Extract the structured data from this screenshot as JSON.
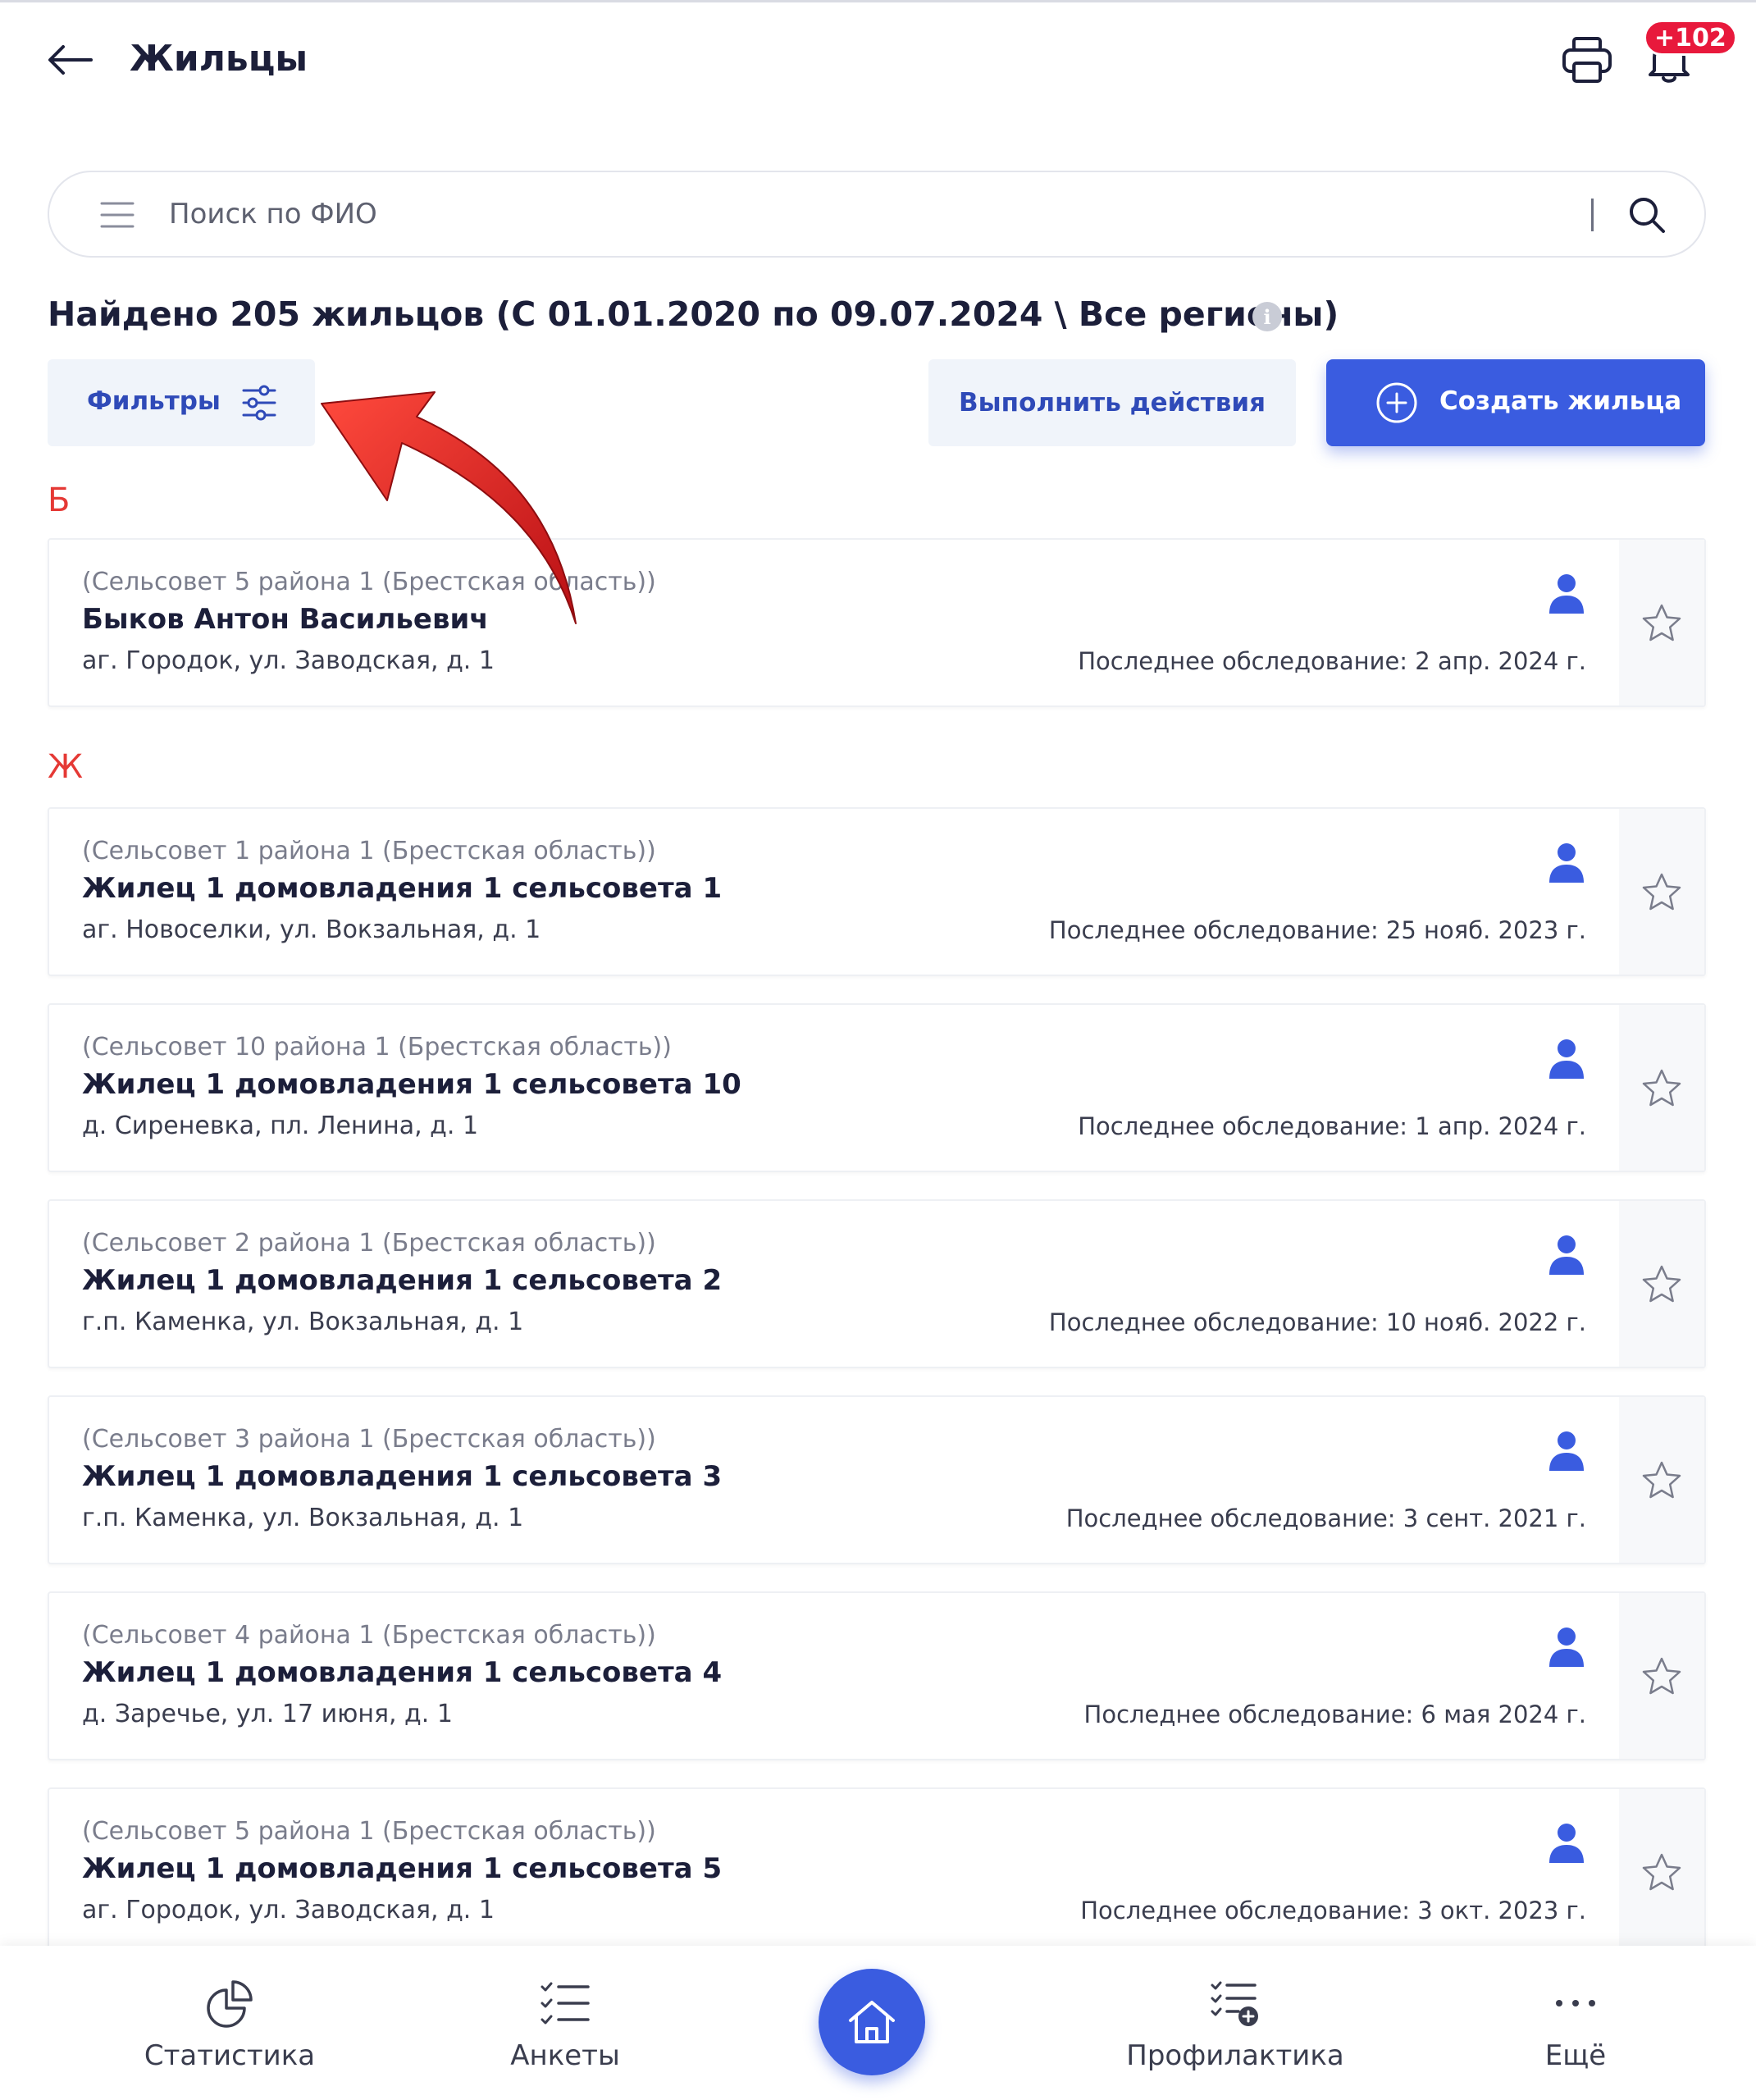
{
  "header": {
    "title": "Жильцы",
    "notification_badge": "+102"
  },
  "search": {
    "placeholder": "Поиск по ФИО",
    "value": ""
  },
  "summary": {
    "found_text": "Найдено 205 жильцов (С 01.01.2020 по 09.07.2024 \\ Все регионы)"
  },
  "toolbar": {
    "filters_label": "Фильтры",
    "actions_label": "Выполнить действия",
    "create_label": "Создать жильца"
  },
  "sections": [
    {
      "letter": "Б",
      "residents": [
        {
          "region": "(Сельсовет 5 района 1 (Брестская область))",
          "name": "Быков Антон Васильевич",
          "address": "аг. Городок, ул. Заводская, д. 1",
          "last_inspection": "Последнее обследование: 2 апр. 2024 г."
        }
      ]
    },
    {
      "letter": "Ж",
      "residents": [
        {
          "region": "(Сельсовет 1 района 1 (Брестская область))",
          "name": "Жилец 1 домовладения 1 сельсовета 1",
          "address": "аг. Новоселки, ул. Вокзальная, д. 1",
          "last_inspection": "Последнее обследование: 25 нояб. 2023 г."
        },
        {
          "region": "(Сельсовет 10 района 1 (Брестская область))",
          "name": "Жилец 1 домовладения 1 сельсовета 10",
          "address": "д. Сиреневка, пл. Ленина, д. 1",
          "last_inspection": "Последнее обследование: 1 апр. 2024 г."
        },
        {
          "region": "(Сельсовет 2 района 1 (Брестская область))",
          "name": "Жилец 1 домовладения 1 сельсовета 2",
          "address": "г.п. Каменка, ул. Вокзальная, д. 1",
          "last_inspection": "Последнее обследование: 10 нояб. 2022 г."
        },
        {
          "region": "(Сельсовет 3 района 1 (Брестская область))",
          "name": "Жилец 1 домовладения 1 сельсовета 3",
          "address": "г.п. Каменка, ул. Вокзальная, д. 1",
          "last_inspection": "Последнее обследование: 3 сент. 2021 г."
        },
        {
          "region": "(Сельсовет 4 района 1 (Брестская область))",
          "name": "Жилец 1 домовладения 1 сельсовета 4",
          "address": "д. Заречье, ул. 17 июня, д. 1",
          "last_inspection": "Последнее обследование: 6 мая 2024 г."
        },
        {
          "region": "(Сельсовет 5 района 1 (Брестская область))",
          "name": "Жилец 1 домовладения 1 сельсовета 5",
          "address": "аг. Городок, ул. Заводская, д. 1",
          "last_inspection": "Последнее обследование: 3 окт. 2023 г."
        }
      ]
    }
  ],
  "bottom_nav": {
    "statistics": "Статистика",
    "questionnaires": "Анкеты",
    "prevention": "Профилактика",
    "more": "Ещё"
  },
  "colors": {
    "accent": "#3a5ce0",
    "section_letter": "#e53935",
    "badge": "#e8193c",
    "arrow": "#d81e1e"
  },
  "icons": [
    "back-arrow-icon",
    "printer-icon",
    "bell-icon",
    "menu-icon",
    "search-icon",
    "info-icon",
    "filter-sliders-icon",
    "plus-circle-icon",
    "person-icon",
    "star-icon",
    "pie-chart-icon",
    "checklist-icon",
    "home-icon",
    "checklist-add-icon",
    "more-dots-icon"
  ]
}
